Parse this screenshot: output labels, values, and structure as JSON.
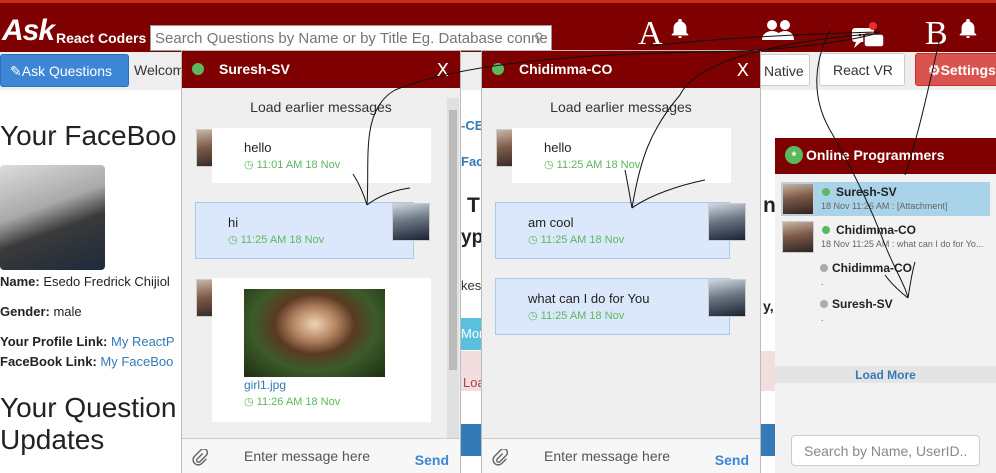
{
  "header": {
    "brand": "Ask",
    "brand_sub": "React Coders",
    "search_placeholder": "Search Questions by Name or by Title Eg. Database connection",
    "label_a": "A",
    "label_b": "B"
  },
  "toolbar": {
    "ask_button": "Ask Questions",
    "welcome": "Welcom",
    "native_button": "Native",
    "vr_button": "React VR",
    "settings_button": "Settings"
  },
  "profile": {
    "title": "Your FaceBoo",
    "name_label": "Name:",
    "name_value": "Esedo Fredrick Chijiol",
    "gender_label": "Gender:",
    "gender_value": "male",
    "profile_link_label": "Your Profile Link:",
    "profile_link_value": "My ReactP",
    "fb_link_label": "FaceBook Link:",
    "fb_link_value": "My FaceBoo",
    "questions_title_1": "Your Question",
    "questions_title_2": "Updates"
  },
  "middle": {
    "ce": "-CE",
    "fac": "Fac",
    "t": "T",
    "ype": "ype",
    "kes": "kes",
    "more": "More",
    "loa": "Loa",
    "n": "n",
    "comma": "y, I"
  },
  "chat1": {
    "name": "Suresh-SV",
    "close": "X",
    "load_earlier": "Load earlier messages",
    "messages": [
      {
        "text": "hello",
        "time": "11:01 AM 18 Nov"
      },
      {
        "text": "hi",
        "time": "11:25 AM 18 Nov"
      },
      {
        "file": "girl1.jpg",
        "time": "11:26 AM 18 Nov"
      }
    ],
    "input_placeholder": "Enter message here",
    "send": "Send"
  },
  "chat2": {
    "name": "Chidimma-CO",
    "close": "X",
    "load_earlier": "Load earlier messages",
    "messages": [
      {
        "text": "hello",
        "time": "11:25 AM 18 Nov"
      },
      {
        "text": "am cool",
        "time": "11:25 AM 18 Nov"
      },
      {
        "text": "what can I do for You",
        "time": "11:25 AM 18 Nov"
      }
    ],
    "input_placeholder": "Enter message here",
    "send": "Send"
  },
  "online": {
    "title": "Online Programmers",
    "star": "*",
    "items": [
      {
        "name": "Suresh-SV",
        "sub": "18 Nov 11:26 AM : [Attachment]"
      },
      {
        "name": "Chidimma-CO",
        "sub": "18 Nov 11:25 AM : what can I do for Yo..."
      },
      {
        "name": "Chidimma-CO",
        "sub": "."
      },
      {
        "name": "Suresh-SV",
        "sub": "."
      }
    ],
    "load_more": "Load More",
    "search_placeholder": "Search by Name, UserID.."
  },
  "colors": {
    "header": "#7f0000",
    "accent_blue": "#3d86d6",
    "online_green": "#5cb85c",
    "danger": "#d9534f"
  },
  "icons": [
    "bell-icon",
    "users-icon",
    "chat-icon",
    "paperclip-icon",
    "pencil-icon",
    "gear-icon",
    "search-icon"
  ]
}
